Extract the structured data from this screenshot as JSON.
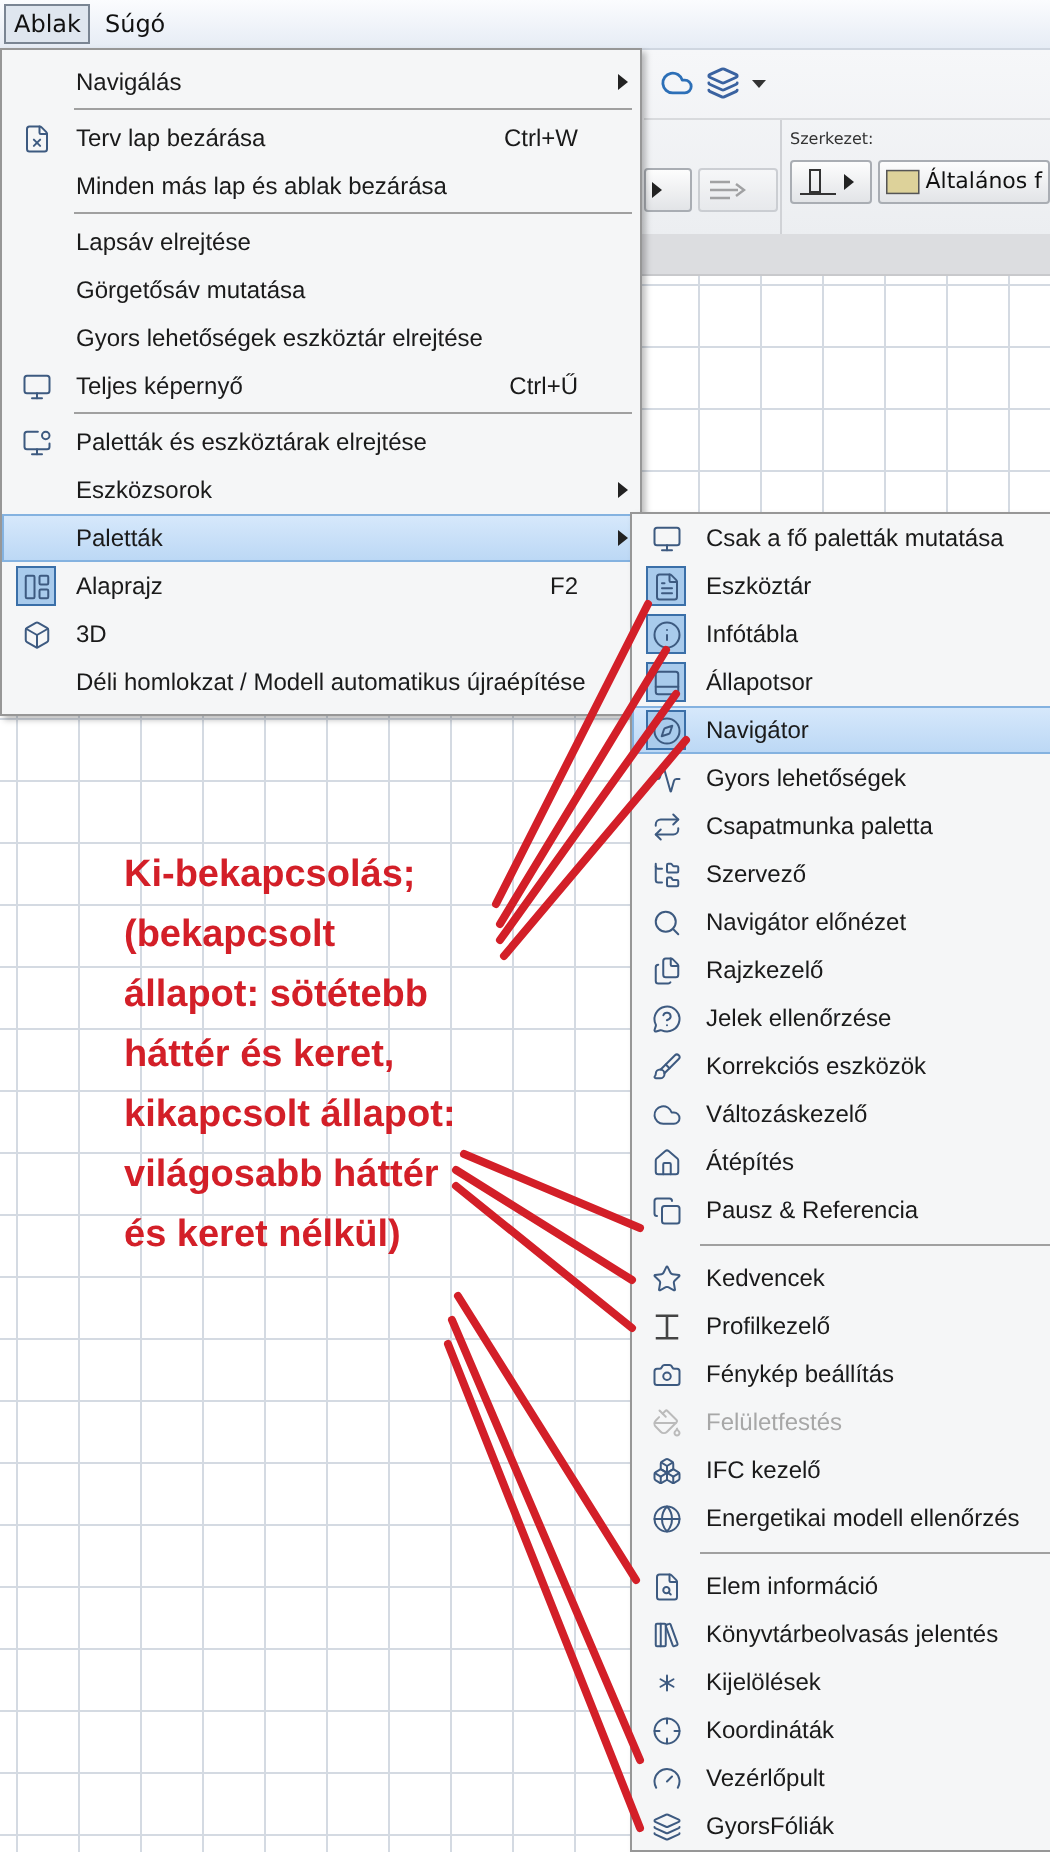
{
  "menu_bar": [
    {
      "label": "Ablak",
      "selected": true
    },
    {
      "label": "Súgó",
      "selected": false
    }
  ],
  "toolbar": {
    "section_label": "Szerkezet:",
    "fill_button": "Általános f"
  },
  "window_menu": {
    "groups": [
      {
        "items": [
          {
            "label": "Navigálás",
            "selected": false,
            "submenu": true
          }
        ]
      },
      {
        "items": [
          {
            "label": "Terv lap bezárása",
            "shortcut": "Ctrl+W",
            "selected": false,
            "submenu": false,
            "checked": false
          },
          {
            "label": "Minden más lap és ablak bezárása",
            "selected": false,
            "submenu": false
          }
        ]
      },
      {
        "items": [
          {
            "label": "Lapsáv elrejtése",
            "selected": false,
            "submenu": false
          },
          {
            "label": "Görgetősáv mutatása",
            "selected": false,
            "submenu": false
          },
          {
            "label": "Gyors lehetőségek eszköztár elrejtése",
            "selected": false,
            "submenu": false
          },
          {
            "label": "Teljes képernyő",
            "shortcut": "Ctrl+Ű",
            "selected": false,
            "submenu": false,
            "checked": false
          }
        ]
      },
      {
        "items": [
          {
            "label": "Paletták és eszköztárak elrejtése",
            "selected": false,
            "submenu": false,
            "checked": false
          },
          {
            "label": "Eszközsorok",
            "selected": false,
            "submenu": true
          },
          {
            "label": "Paletták",
            "selected": true,
            "submenu": true
          },
          {
            "label": "Alaprajz",
            "shortcut": "F2",
            "selected": false,
            "submenu": false,
            "checked": true
          },
          {
            "label": "3D",
            "selected": false,
            "submenu": false,
            "checked": false
          },
          {
            "label": "Déli homlokzat / Modell automatikus újraépítése",
            "selected": false,
            "submenu": false
          }
        ]
      }
    ]
  },
  "palettes_menu": {
    "groups": [
      {
        "items": [
          {
            "label": "Csak a fő paletták mutatása",
            "checked": false,
            "selected": false,
            "disabled": false
          },
          {
            "label": "Eszköztár",
            "checked": true,
            "selected": false,
            "disabled": false
          },
          {
            "label": "Infótábla",
            "checked": true,
            "selected": false,
            "disabled": false
          },
          {
            "label": "Állapotsor",
            "checked": true,
            "selected": false,
            "disabled": false
          },
          {
            "label": "Navigátor",
            "checked": true,
            "selected": true,
            "disabled": false
          },
          {
            "label": "Gyors lehetőségek",
            "checked": false,
            "selected": false,
            "disabled": false
          },
          {
            "label": "Csapatmunka paletta",
            "checked": false,
            "selected": false,
            "disabled": false
          },
          {
            "label": "Szervező",
            "checked": false,
            "selected": false,
            "disabled": false
          },
          {
            "label": "Navigátor előnézet",
            "checked": false,
            "selected": false,
            "disabled": false
          },
          {
            "label": "Rajzkezelő",
            "checked": false,
            "selected": false,
            "disabled": false
          },
          {
            "label": "Jelek ellenőrzése",
            "checked": false,
            "selected": false,
            "disabled": false
          },
          {
            "label": "Korrekciós eszközök",
            "checked": false,
            "selected": false,
            "disabled": false
          },
          {
            "label": "Változáskezelő",
            "checked": false,
            "selected": false,
            "disabled": false
          },
          {
            "label": "Átépítés",
            "checked": false,
            "selected": false,
            "disabled": false
          },
          {
            "label": "Pausz & Referencia",
            "checked": false,
            "selected": false,
            "disabled": false
          }
        ]
      },
      {
        "items": [
          {
            "label": "Kedvencek",
            "checked": false,
            "selected": false,
            "disabled": false
          },
          {
            "label": "Profilkezelő",
            "checked": false,
            "selected": false,
            "disabled": false
          },
          {
            "label": "Fénykép beállítás",
            "checked": false,
            "selected": false,
            "disabled": false
          },
          {
            "label": "Felületfestés",
            "checked": false,
            "selected": false,
            "disabled": true
          },
          {
            "label": "IFC kezelő",
            "checked": false,
            "selected": false,
            "disabled": false
          },
          {
            "label": "Energetikai modell ellenőrzés",
            "checked": false,
            "selected": false,
            "disabled": false
          }
        ]
      },
      {
        "items": [
          {
            "label": "Elem információ",
            "checked": false,
            "selected": false,
            "disabled": false
          },
          {
            "label": "Könyvtárbeolvasás jelentés",
            "checked": false,
            "selected": false,
            "disabled": false
          },
          {
            "label": "Kijelölések",
            "checked": false,
            "selected": false,
            "disabled": false
          },
          {
            "label": "Koordináták",
            "checked": false,
            "selected": false,
            "disabled": false
          },
          {
            "label": "Vezérlőpult",
            "checked": false,
            "selected": false,
            "disabled": false
          },
          {
            "label": "GyorsFóliák",
            "checked": false,
            "selected": false,
            "disabled": false
          }
        ]
      }
    ]
  },
  "annotation": "Ki-bekapcsolás; (bekapcsolt állapot: sötétebb háttér és keret, kikapcsolt állapot: világosabb háttér és keret nélkül)"
}
